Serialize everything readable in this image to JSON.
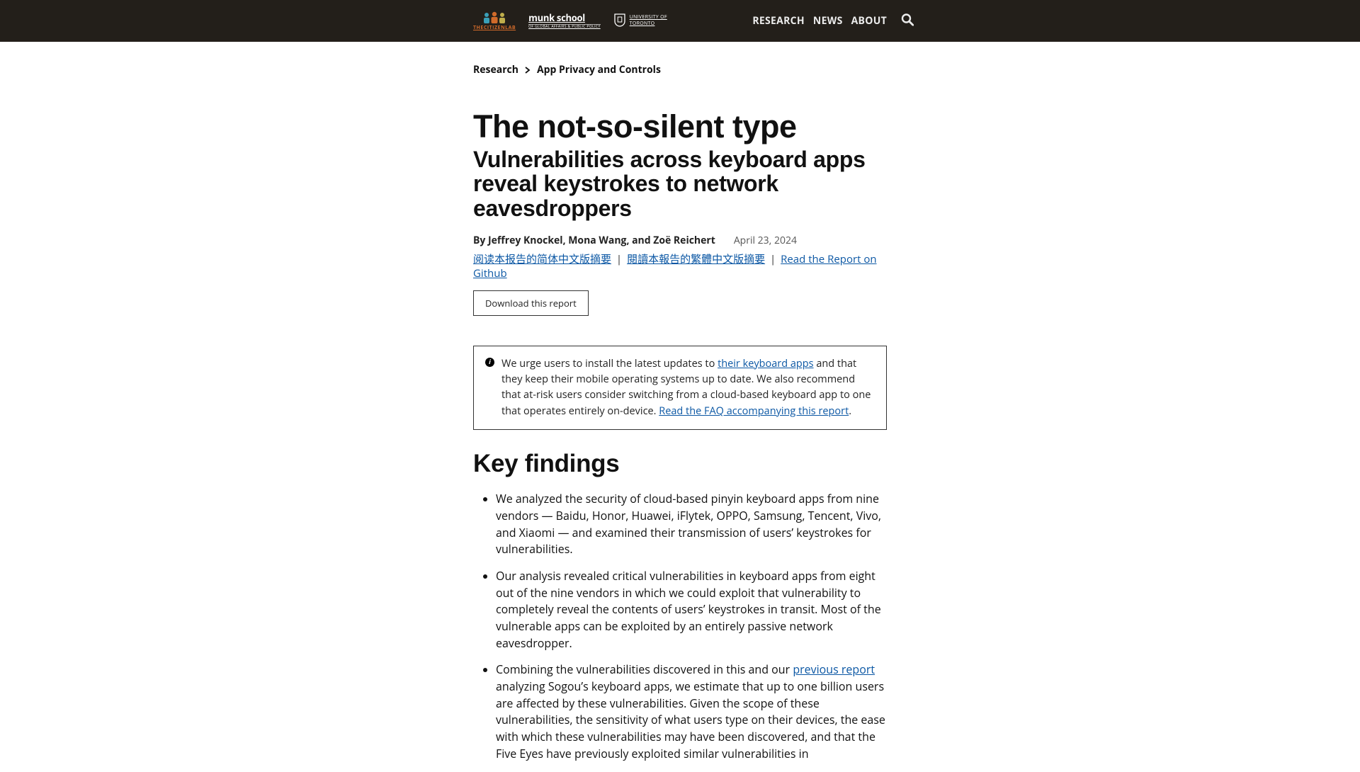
{
  "nav": {
    "research": "RESEARCH",
    "news": "NEWS",
    "about": "ABOUT"
  },
  "logos": {
    "citizenlab": "THECITIZENLAB",
    "munk_big": "munk school",
    "munk_small": "OF GLOBAL AFFAIRS & PUBLIC POLICY",
    "uoft_line1": "UNIVERSITY OF",
    "uoft_line2": "TORONTO"
  },
  "breadcrumb": {
    "item1": "Research",
    "item2": "App Privacy and Controls"
  },
  "title": "The not-so-silent type",
  "subtitle": "Vulnerabilities across keyboard apps reveal keystrokes to network eavesdroppers",
  "byline": "By Jeffrey Knockel, Mona Wang, and Zoë Reichert",
  "date": "April 23, 2024",
  "links": {
    "simplified": "阅读本报告的简体中文版摘要",
    "traditional": "閱讀本報告的繁體中文版摘要",
    "github": "Read the Report on Github",
    "sep": " | "
  },
  "download_label": "Download this report",
  "callout": {
    "pre": "We urge users to install the latest updates to ",
    "link1": "their keyboard apps",
    "mid": " and that they keep their mobile operating systems up to date. We also recommend that at-risk users consider switching from a cloud-based keyboard app to one that operates entirely on-device. ",
    "link2": "Read the FAQ accompanying this report",
    "post": "."
  },
  "key_findings_heading": "Key findings",
  "findings": {
    "f1": "We analyzed the security of cloud-based pinyin keyboard apps from nine vendors — Baidu, Honor, Huawei, iFlytek, OPPO, Samsung, Tencent, Vivo, and Xiaomi — and examined their transmission of users’ keystrokes for vulnerabilities.",
    "f2": "Our analysis revealed critical vulnerabilities in keyboard apps from eight out of the nine vendors in which we could exploit that vulnerability to completely reveal the contents of users’ keystrokes in transit. Most of the vulnerable apps can be exploited by an entirely passive network eavesdropper.",
    "f3_pre": "Combining the vulnerabilities discovered in this and our ",
    "f3_link": "previous report",
    "f3_post": " analyzing Sogou’s keyboard apps, we estimate that up to one billion users are affected by these vulnerabilities. Given the scope of these vulnerabilities, the sensitivity of what users type on their devices, the ease with which these vulnerabilities may have been discovered, and that the Five Eyes have previously exploited similar vulnerabilities in"
  }
}
